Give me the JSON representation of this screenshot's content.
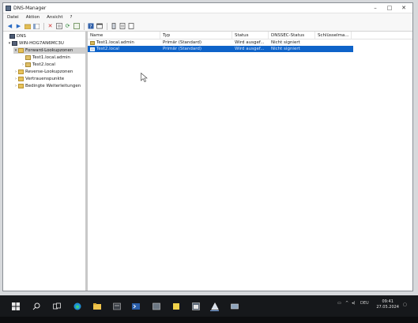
{
  "window": {
    "title": "DNS-Manager",
    "controls": [
      "–",
      "□",
      "✕"
    ]
  },
  "menu": [
    "Datei",
    "Aktion",
    "Ansicht",
    "?"
  ],
  "tree": {
    "root": "DNS",
    "server": "WIN-HOG7AN6MC3U",
    "forward": "Forward-Lookupzonen",
    "zone1": "Test1.local.admin",
    "zone2": "Test2.local",
    "reverse": "Reverse-Lookupzonen",
    "trustpoints": "Vertrauenspunkte",
    "conditional": "Bedingte Weiterleitungen"
  },
  "list": {
    "columns": [
      "Name",
      "Typ",
      "Status",
      "DNSSEC-Status",
      "Schlüsselma..."
    ],
    "rows": [
      [
        "Test1.local.admin",
        "Primär (Standard)",
        "Wird ausgef...",
        "Nicht signiert"
      ],
      [
        "Test2.local",
        "Primär (Standard)",
        "Wird ausgef...",
        "Nicht signiert"
      ]
    ],
    "selected_row": 1
  },
  "taskbar": {
    "language": "DEU",
    "time": "09:41",
    "date": "27.05.2024"
  },
  "colors": {
    "selection": "#0e63c9",
    "taskbar": "#16181b"
  }
}
